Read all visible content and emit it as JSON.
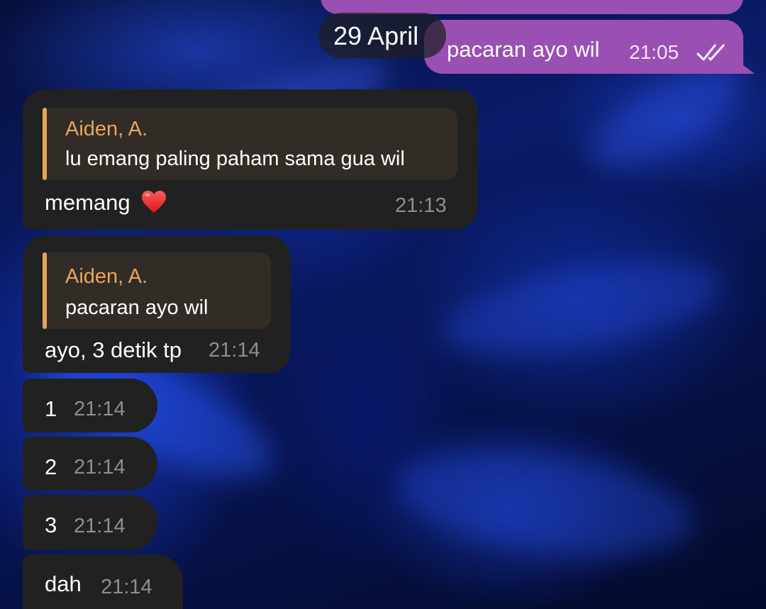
{
  "background": {
    "wallpaper": "blue abstract smoke",
    "accent": "#1e46d6"
  },
  "colors": {
    "outgoing_bubble": "#9a4fb3",
    "incoming_bubble": "#212121",
    "reply_box": "#322c26",
    "reply_accent": "#e5a552",
    "reply_name": "#e9a55d",
    "timestamp": "#8e8e8e"
  },
  "date_separator": "29 April",
  "outgoing": {
    "text": "pacaran ayo wil",
    "time": "21:05",
    "status_icon": "double-check-icon"
  },
  "messages": [
    {
      "reply_name": "Aiden, A.",
      "reply_text": "lu emang paling paham sama gua wil",
      "text": "memang",
      "emoji": "heart-icon",
      "time": "21:13"
    },
    {
      "reply_name": "Aiden, A.",
      "reply_text": "pacaran ayo wil",
      "text": "ayo, 3 detik tp",
      "time": "21:14"
    },
    {
      "text": "1",
      "time": "21:14"
    },
    {
      "text": "2",
      "time": "21:14"
    },
    {
      "text": "3",
      "time": "21:14"
    },
    {
      "text": "dah",
      "time": "21:14"
    }
  ]
}
